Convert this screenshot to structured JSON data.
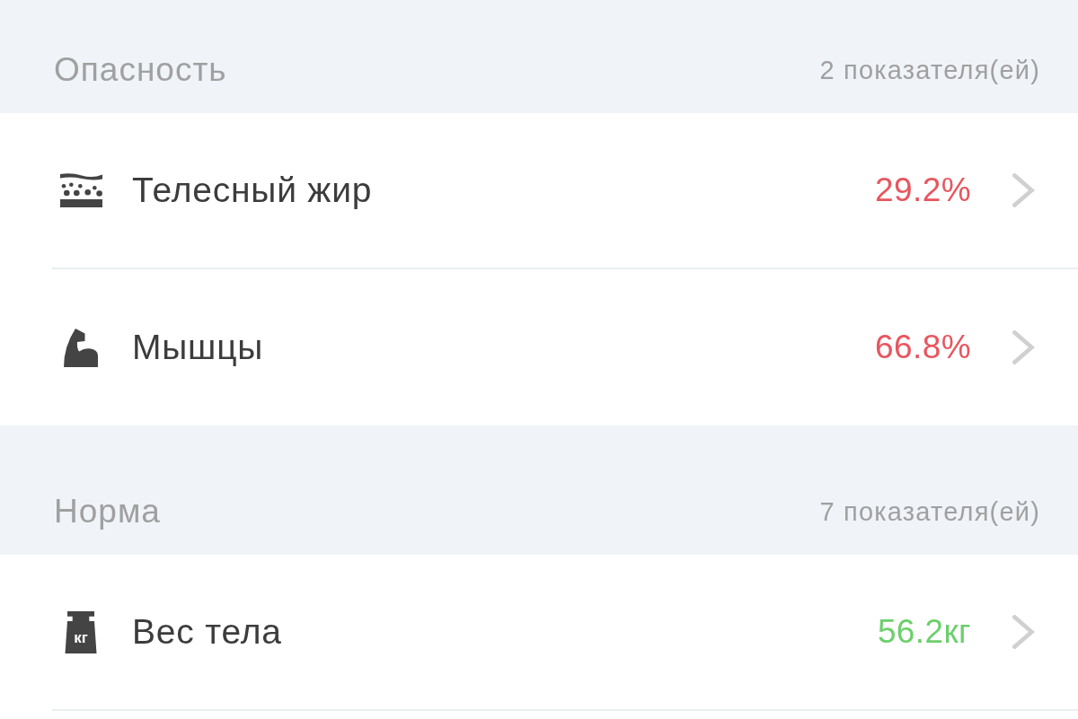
{
  "sections": [
    {
      "title": "Опасность",
      "count": "2 показателя(ей)",
      "items": [
        {
          "kind": "fat",
          "label": "Телесный жир",
          "value": "29.2%",
          "color": "#e8565f"
        },
        {
          "kind": "muscle",
          "label": "Мышцы",
          "value": "66.8%",
          "color": "#e8565f"
        }
      ]
    },
    {
      "title": "Норма",
      "count": "7 показателя(ей)",
      "items": [
        {
          "kind": "weight",
          "icon_text": "кг",
          "label": "Вес тела",
          "value": "56.2кг",
          "color": "#6dce6d"
        }
      ]
    }
  ]
}
